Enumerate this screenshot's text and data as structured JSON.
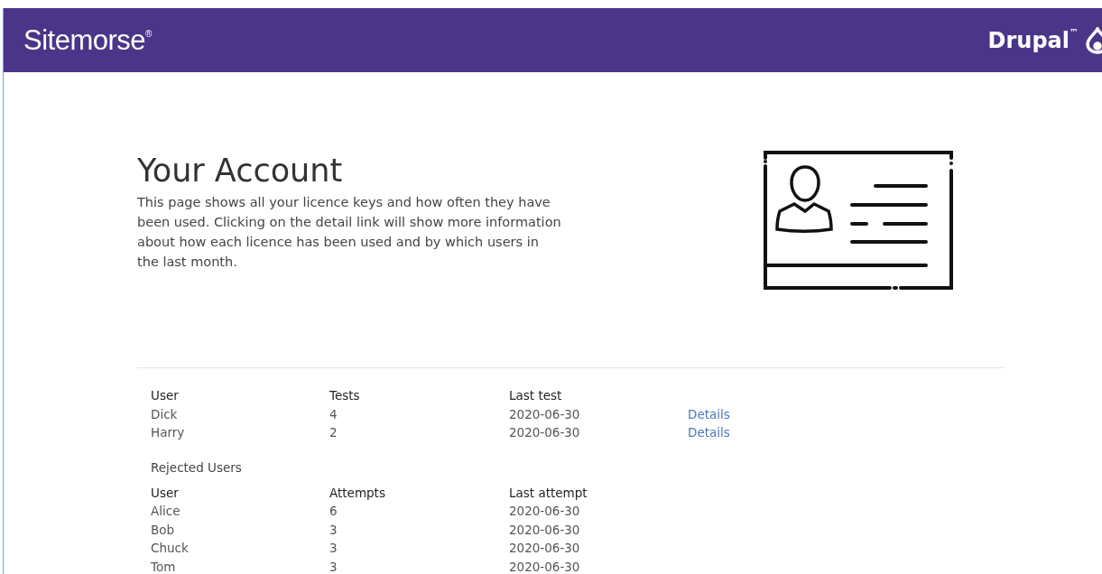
{
  "header": {
    "brand": "Sitemorse",
    "brand_mark": "®",
    "partner": "Drupal",
    "partner_mark": "™"
  },
  "page": {
    "title": "Your Account",
    "intro": "This page shows all your licence keys and how often they have been used. Clicking on the detail link will show more information about how each licence has been used and by which users in the last month."
  },
  "usage": {
    "columns": [
      "User",
      "Tests",
      "Last test"
    ],
    "rows": [
      {
        "cells": [
          "Dick",
          "4",
          "2020-06-30"
        ],
        "link": "Details"
      },
      {
        "cells": [
          "Harry",
          "2",
          "2020-06-30"
        ],
        "link": "Details"
      }
    ]
  },
  "rejected": {
    "title": "Rejected Users",
    "columns": [
      "User",
      "Attempts",
      "Last attempt"
    ],
    "rows": [
      {
        "cells": [
          "Alice",
          "6",
          "2020-06-30"
        ]
      },
      {
        "cells": [
          "Bob",
          "3",
          "2020-06-30"
        ]
      },
      {
        "cells": [
          "Chuck",
          "3",
          "2020-06-30"
        ]
      },
      {
        "cells": [
          "Tom",
          "3",
          "2020-06-30"
        ]
      }
    ]
  }
}
